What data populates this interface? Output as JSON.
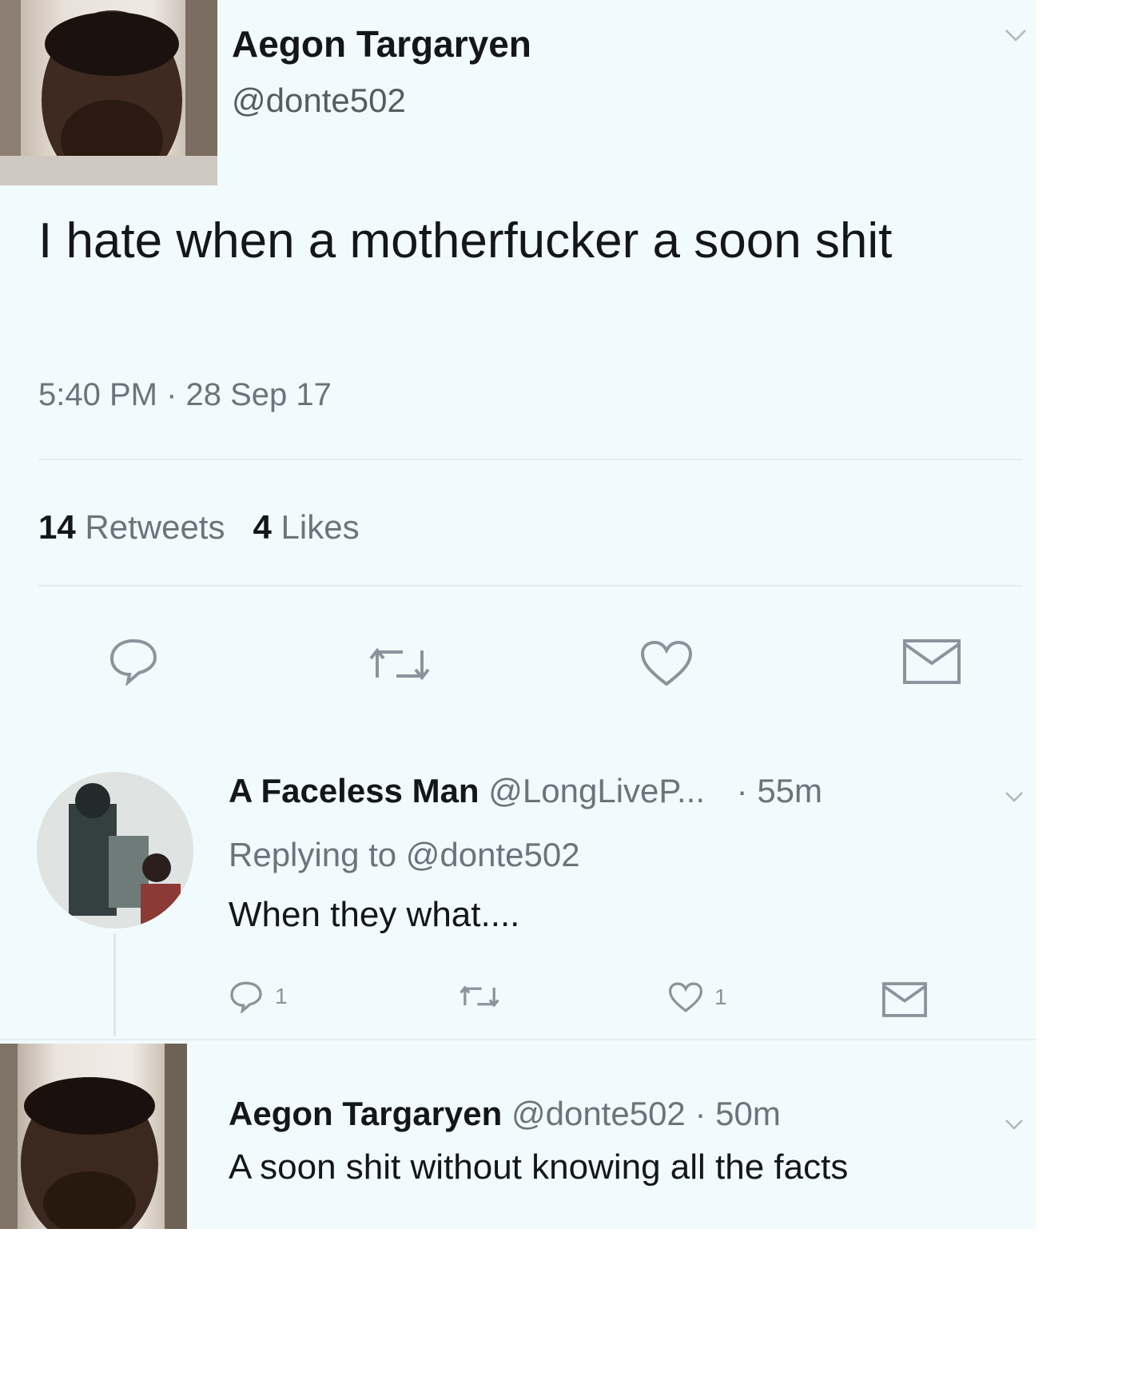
{
  "tweet": {
    "author_name": "Aegon Targaryen",
    "author_handle": "@donte502",
    "text": "I hate when a motherfucker a soon shit",
    "timestamp": "5:40 PM · 28 Sep 17",
    "retweet_count": "14",
    "retweet_label": "Retweets",
    "like_count": "4",
    "like_label": "Likes",
    "icons": [
      "reply-icon",
      "retweet-icon",
      "like-icon",
      "message-icon"
    ]
  },
  "reply": {
    "author_name": "A Faceless Man",
    "author_handle": "@LongLiveP...",
    "time": "· 55m",
    "replying_label": "Replying to",
    "replying_handle": "@donte502",
    "text": "When they what....",
    "reply_count": "1",
    "like_count": "1"
  },
  "reply2": {
    "author_name": "Aegon Targaryen",
    "author_handle": "@donte502",
    "time": "· 50m",
    "text": "A soon shit without knowing all the facts"
  },
  "colors": {
    "background": "#f1fafd",
    "text": "#14171a",
    "secondary_text": "#6b747c",
    "icon": "#8a949c"
  }
}
